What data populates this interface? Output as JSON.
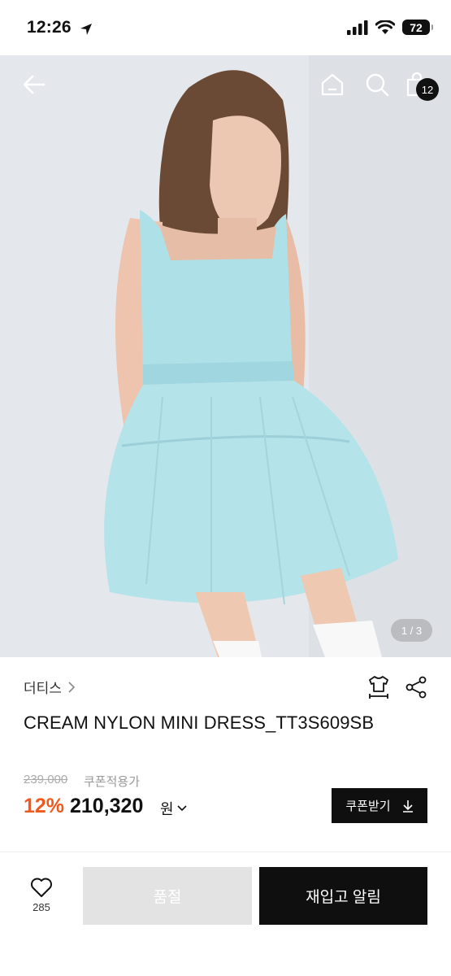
{
  "status_bar": {
    "time": "12:26",
    "battery": "72"
  },
  "hero": {
    "cart_count": "12",
    "page_indicator": "1 / 3"
  },
  "product": {
    "brand": "더티스",
    "title": "CREAM NYLON MINI DRESS_TT3S609SB",
    "original_price": "239,000",
    "coupon_label": "쿠폰적용가",
    "discount": "12%",
    "sale_price": "210,320",
    "currency": "원",
    "coupon_button": "쿠폰받기"
  },
  "bottom_bar": {
    "like_count": "285",
    "soldout_label": "품절",
    "restock_label": "재입고 알림"
  },
  "colors": {
    "accent": "#f05a1e",
    "dark": "#0f0f0f",
    "disabled": "#e3e3e3"
  }
}
